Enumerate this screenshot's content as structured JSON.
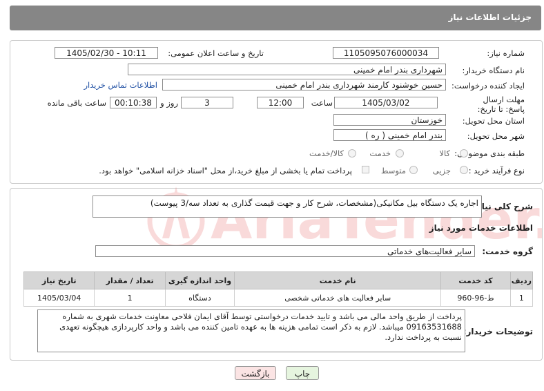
{
  "header": {
    "title": "جزئیات اطلاعات نیاز"
  },
  "fields": {
    "need_number_label": "شماره نیاز:",
    "need_number": "1105095076000034",
    "announce_label": "تاریخ و ساعت اعلان عمومی:",
    "announce_value": "1405/02/30 - 10:11",
    "buyer_org_label": "نام دستگاه خریدار:",
    "buyer_org": "شهرداری بندر امام خمینی",
    "creator_label": "ایجاد کننده درخواست:",
    "creator": "حسین خوشنود کارمند شهرداری بندر امام خمینی",
    "contact_link": "اطلاعات تماس خریدار",
    "deadline_label": "مهلت ارسال پاسخ: تا تاریخ:",
    "deadline_date": "1405/03/02",
    "time_label": "ساعت",
    "deadline_time": "12:00",
    "days_value": "3",
    "days_label": "روز و",
    "remaining_time": "00:10:38",
    "remaining_label": "ساعت باقی مانده",
    "province_label": "استان محل تحویل:",
    "province": "خوزستان",
    "city_label": "شهر محل تحویل:",
    "city": "بندر امام خمینی ( ره )",
    "category_label": "طبقه بندی موضوعی:",
    "category_options": [
      "کالا",
      "خدمت",
      "کالا/خدمت"
    ],
    "process_label": "نوع فرآیند خرید :",
    "process_options": [
      "جزیی",
      "متوسط"
    ],
    "payment_note": "پرداخت تمام یا بخشی از مبلغ خرید،از محل \"اسناد خزانه اسلامی\" خواهد بود."
  },
  "summary": {
    "label": "شرح کلی نیاز:",
    "text": "اجاره یک دستگاه بیل مکانیکی(مشخصات، شرح کار و جهت قیمت گذاری به تعداد سه/3 پیوست)"
  },
  "services": {
    "section_title": "اطلاعات خدمات مورد نیاز",
    "group_label": "گروه خدمت:",
    "group_value": "سایر فعالیت‌های خدماتی",
    "columns": [
      "ردیف",
      "کد خدمت",
      "نام خدمت",
      "واحد اندازه گیری",
      "تعداد / مقدار",
      "تاریخ نیاز"
    ],
    "rows": [
      {
        "row": "1",
        "code": "ط-96-960",
        "name": "سایر فعالیت های خدماتی شخصی",
        "unit": "دستگاه",
        "qty": "1",
        "date": "1405/03/04"
      }
    ]
  },
  "buyer_notes": {
    "label": "توضیحات خریدار:",
    "text": "پرداخت از طریق واحد مالی می باشد و تایید خدمات درخواستی توسط آقای ایمان فلاحی معاونت خدمات شهری به شماره 09163531688 میباشد. لازم به ذکر است تمامی هزینه ها به عهده تامین کننده می باشد و واحد کارپردازی هیچگونه تعهدی نسبت به پرداخت ندارد."
  },
  "buttons": {
    "print": "چاپ",
    "back": "بازگشت"
  },
  "watermark": {
    "text": "AriaTender.neT"
  },
  "colors": {
    "header_bg": "#868686",
    "link": "#1f4fa3",
    "print_btn": "#e6f5df",
    "back_btn": "#fbe4e4"
  }
}
